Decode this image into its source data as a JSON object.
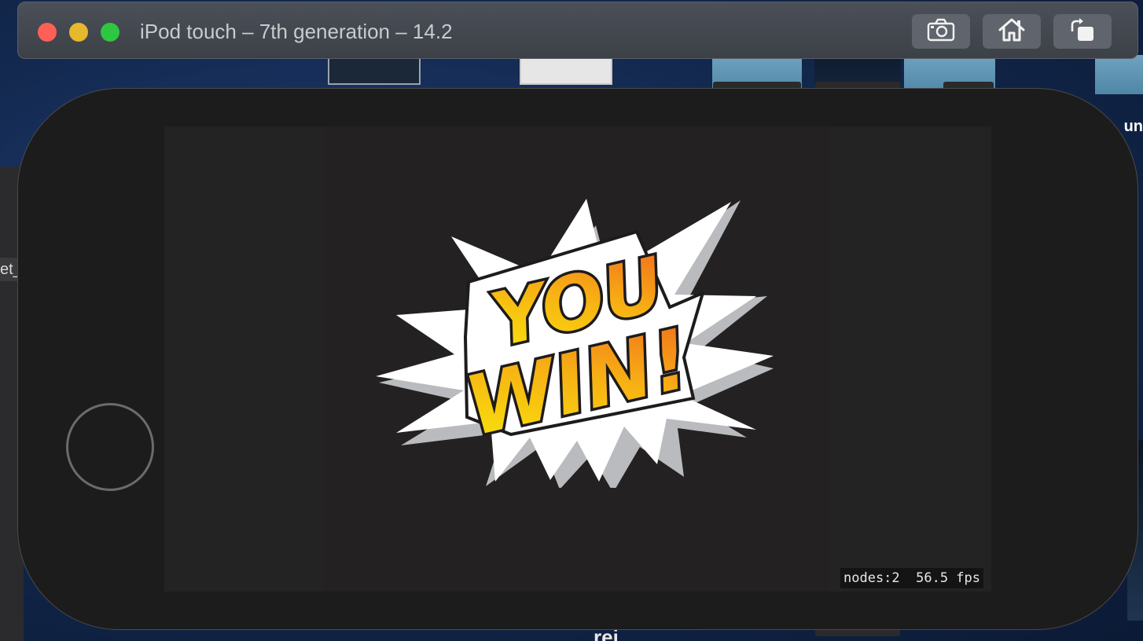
{
  "window": {
    "title": "iPod touch – 7th generation – 14.2"
  },
  "toolbar": {
    "screenshot_label": "Screenshot",
    "home_label": "Home",
    "rotate_label": "Rotate"
  },
  "desktop": {
    "left_text": "et_",
    "right_text": "un",
    "bottom_text": "rei"
  },
  "game": {
    "banner_line1": "YOU",
    "banner_line2": "WIN!",
    "stats_text": "nodes:2  56.5 fps"
  },
  "colors": {
    "titlebar": "#43474e",
    "device_body": "#1c1c1c",
    "screen_background": "#242122",
    "banner_yellow": "#f5e20a",
    "banner_orange": "#f07a1c"
  },
  "icons": {
    "screenshot": "camera-icon",
    "home": "house-icon",
    "rotate": "rotate-icon"
  }
}
